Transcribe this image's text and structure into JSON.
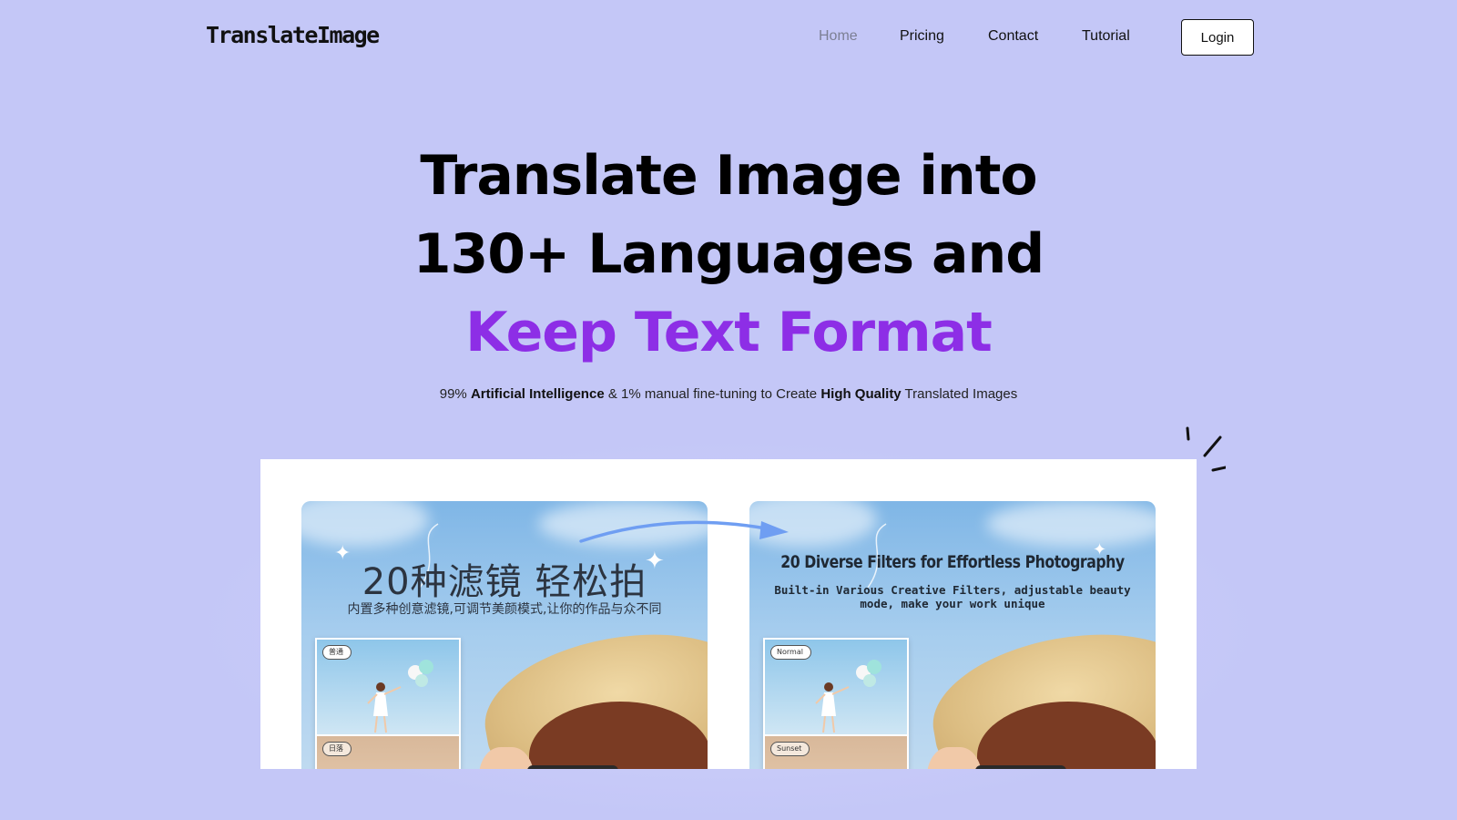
{
  "header": {
    "logo": "TranslateImage",
    "nav": [
      {
        "label": "Home",
        "active": true
      },
      {
        "label": "Pricing",
        "active": false
      },
      {
        "label": "Contact",
        "active": false
      },
      {
        "label": "Tutorial",
        "active": false
      }
    ],
    "login_label": "Login"
  },
  "hero": {
    "line1": "Translate Image into",
    "line2": "130+ Languages and",
    "line3": "Keep Text Format",
    "accent_color": "#8d2ee6",
    "subtitle_parts": {
      "p1": "99% ",
      "b1": "Artificial Intelligence",
      "p2": " & 1% manual fine-tuning to Create ",
      "b2": "High Quality",
      "p3": " Translated Images"
    }
  },
  "showcase": {
    "original": {
      "title": "20种滤镜 轻松拍",
      "subtitle": "内置多种创意滤镜,可调节美颜模式,让你的作品与众不同",
      "tag_top": "普通",
      "tag_bottom": "日落"
    },
    "translated": {
      "title": "20 Diverse Filters for Effortless Photography",
      "subtitle": "Built-in Various Creative Filters, adjustable beauty mode, make your work unique",
      "tag_top": "Normal",
      "tag_bottom": "Sunset"
    }
  },
  "colors": {
    "background": "#c4c7f7",
    "accent": "#8d2ee6",
    "arrow": "#6f9ef2"
  }
}
